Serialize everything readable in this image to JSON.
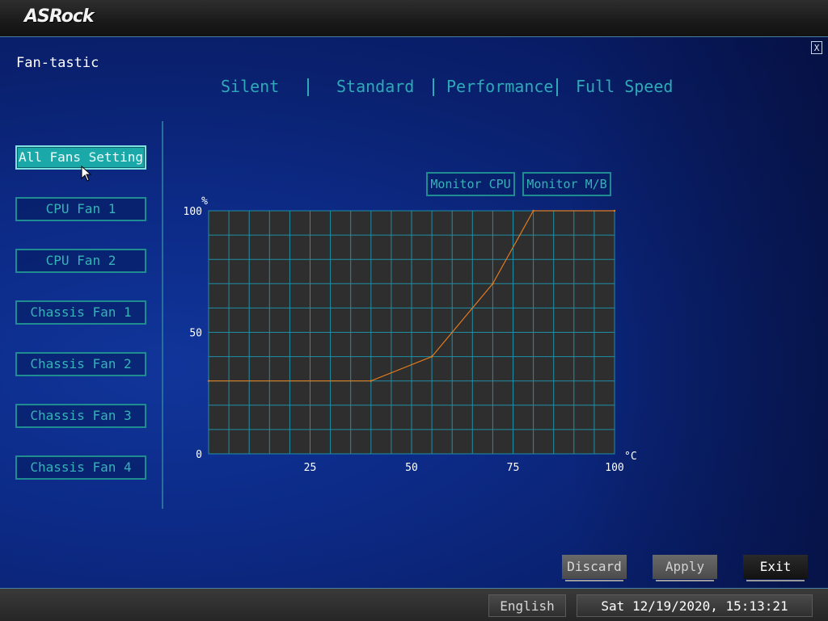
{
  "brand": {
    "logo_text": "ASRock"
  },
  "window": {
    "title": "Fan-tastic",
    "close_label": "X"
  },
  "fan_list": [
    {
      "label": "All Fans Setting",
      "active": true
    },
    {
      "label": "CPU Fan 1",
      "active": false
    },
    {
      "label": "CPU Fan 2",
      "active": false
    },
    {
      "label": "Chassis Fan 1",
      "active": false
    },
    {
      "label": "Chassis Fan 2",
      "active": false
    },
    {
      "label": "Chassis Fan 3",
      "active": false
    },
    {
      "label": "Chassis Fan 4",
      "active": false
    }
  ],
  "modes": [
    {
      "label": "Silent"
    },
    {
      "label": "Standard"
    },
    {
      "label": "Performance"
    },
    {
      "label": "Full Speed"
    }
  ],
  "monitor": {
    "cpu_label": "Monitor CPU",
    "mb_label": "Monitor M/B"
  },
  "chart_data": {
    "type": "line",
    "x_unit": "°C",
    "y_unit": "%",
    "xlim": [
      0,
      100
    ],
    "ylim": [
      0,
      100
    ],
    "x_ticks": [
      0,
      25,
      50,
      75,
      100
    ],
    "y_ticks": [
      0,
      50,
      100
    ],
    "x_tick_labels": [
      "25",
      "50",
      "75",
      "100"
    ],
    "y_tick_labels": [
      "0",
      "50",
      "100"
    ],
    "grid": true,
    "series": [
      {
        "points": [
          [
            0,
            30
          ],
          [
            40,
            30
          ],
          [
            55,
            40
          ],
          [
            70,
            70
          ],
          [
            80,
            100
          ],
          [
            100,
            100
          ]
        ],
        "color": "#e07b1e"
      }
    ]
  },
  "actions": {
    "discard": "Discard",
    "apply": "Apply",
    "exit": "Exit"
  },
  "footer": {
    "language": "English",
    "datetime": "Sat 12/19/2020, 15:13:21"
  },
  "colors": {
    "accent": "#1aa8a8",
    "text_accent": "#35b3b6",
    "curve": "#e07b1e",
    "grid": "#1e8fa6"
  }
}
